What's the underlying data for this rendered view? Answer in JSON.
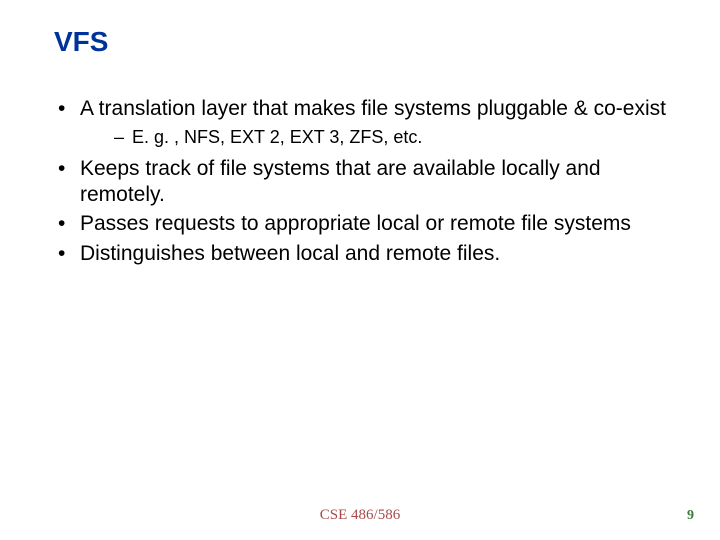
{
  "slide": {
    "title": "VFS",
    "bullets": [
      {
        "text": "A translation layer that makes file systems pluggable & co-exist",
        "sub": [
          "E. g. , NFS, EXT 2, EXT 3, ZFS, etc."
        ]
      },
      {
        "text": "Keeps track of file systems that are available locally and remotely."
      },
      {
        "text": "Passes requests to appropriate local or remote file systems"
      },
      {
        "text": "Distinguishes between local and remote files."
      }
    ],
    "footer_center": "CSE 486/586",
    "page_number": "9"
  }
}
